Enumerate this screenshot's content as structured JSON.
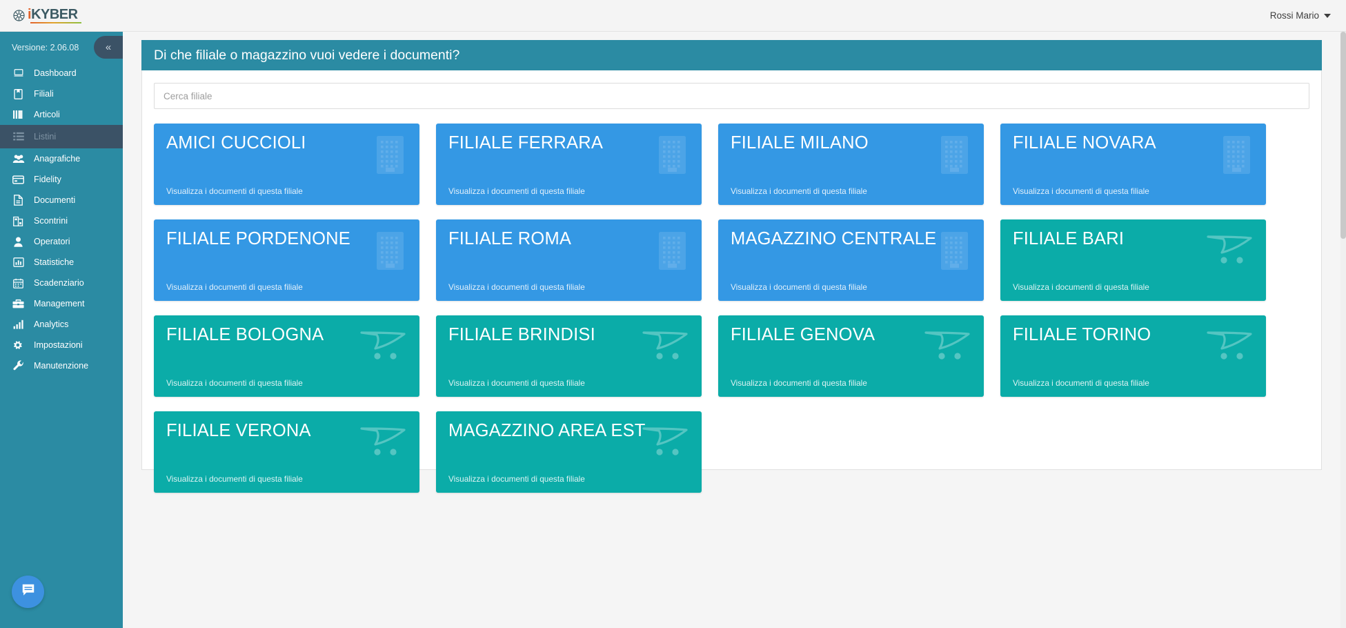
{
  "header": {
    "logo_i": "i",
    "logo_rest": "KYBER",
    "user_name": "Rossi Mario",
    "caret_icon": "chevron-down-icon"
  },
  "sidebar": {
    "version": "Versione: 2.06.08",
    "collapse_label": "«",
    "items": [
      {
        "label": "Dashboard",
        "icon": "monitor-icon",
        "active": false
      },
      {
        "label": "Filiali",
        "icon": "book-icon",
        "active": false
      },
      {
        "label": "Articoli",
        "icon": "columns-icon",
        "active": false
      },
      {
        "label": "Listini",
        "icon": "list-icon",
        "active": true
      },
      {
        "label": "Anagrafiche",
        "icon": "users-icon",
        "active": false
      },
      {
        "label": "Fidelity",
        "icon": "card-icon",
        "active": false
      },
      {
        "label": "Documenti",
        "icon": "file-icon",
        "active": false
      },
      {
        "label": "Scontrini",
        "icon": "receipt-icon",
        "active": false
      },
      {
        "label": "Operatori",
        "icon": "user-icon",
        "active": false
      },
      {
        "label": "Statistiche",
        "icon": "bar-chart-icon",
        "active": false
      },
      {
        "label": "Scadenziario",
        "icon": "calendar-icon",
        "active": false
      },
      {
        "label": "Management",
        "icon": "briefcase-icon",
        "active": false
      },
      {
        "label": "Analytics",
        "icon": "analytics-icon",
        "active": false
      },
      {
        "label": "Impostazioni",
        "icon": "gears-icon",
        "active": false
      },
      {
        "label": "Manutenzione",
        "icon": "wrench-icon",
        "active": false
      }
    ]
  },
  "chat": {
    "icon": "chat-bubble-icon"
  },
  "main": {
    "panel_title": "Di che filiale o magazzino vuoi vedere i documenti?",
    "search": {
      "value": "",
      "placeholder": "Cerca filiale"
    },
    "card_subtitle": "Visualizza i documenti di questa filiale",
    "cards": [
      {
        "title": "AMICI CUCCIOLI",
        "color": "blue",
        "icon": "building-icon",
        "subtitle": "Visualizza i documenti di questa filiale"
      },
      {
        "title": "FILIALE FERRARA",
        "color": "blue",
        "icon": "building-icon",
        "subtitle": "Visualizza i documenti di questa filiale"
      },
      {
        "title": "FILIALE MILANO",
        "color": "blue",
        "icon": "building-icon",
        "subtitle": "Visualizza i documenti di questa filiale"
      },
      {
        "title": "FILIALE NOVARA",
        "color": "blue",
        "icon": "building-icon",
        "subtitle": "Visualizza i documenti di questa filiale"
      },
      {
        "title": "FILIALE PORDENONE",
        "color": "blue",
        "icon": "building-icon",
        "subtitle": "Visualizza i documenti di questa filiale"
      },
      {
        "title": "FILIALE ROMA",
        "color": "blue",
        "icon": "building-icon",
        "subtitle": "Visualizza i documenti di questa filiale"
      },
      {
        "title": "MAGAZZINO CENTRALE",
        "color": "blue",
        "icon": "building-icon",
        "subtitle": "Visualizza i documenti di questa filiale"
      },
      {
        "title": "FILIALE BARI",
        "color": "teal",
        "icon": "cart-icon",
        "subtitle": "Visualizza i documenti di questa filiale"
      },
      {
        "title": "FILIALE BOLOGNA",
        "color": "teal",
        "icon": "cart-icon",
        "subtitle": "Visualizza i documenti di questa filiale"
      },
      {
        "title": "FILIALE BRINDISI",
        "color": "teal",
        "icon": "cart-icon",
        "subtitle": "Visualizza i documenti di questa filiale"
      },
      {
        "title": "FILIALE GENOVA",
        "color": "teal",
        "icon": "cart-icon",
        "subtitle": "Visualizza i documenti di questa filiale"
      },
      {
        "title": "FILIALE TORINO",
        "color": "teal",
        "icon": "cart-icon",
        "subtitle": "Visualizza i documenti di questa filiale"
      },
      {
        "title": "FILIALE VERONA",
        "color": "teal",
        "icon": "cart-icon",
        "subtitle": "Visualizza i documenti di questa filiale"
      },
      {
        "title": "MAGAZZINO AREA EST",
        "color": "teal",
        "icon": "cart-icon",
        "subtitle": "Visualizza i documenti di questa filiale"
      }
    ]
  },
  "colors": {
    "sidebar": "#2b8ba3",
    "sidebar_active": "#3b5266",
    "panel_head": "#2b8ba3",
    "card_blue": "#3498e4",
    "card_teal": "#0baca8",
    "chat_fab": "#3d91e0",
    "logo_orange": "#e2642c"
  }
}
